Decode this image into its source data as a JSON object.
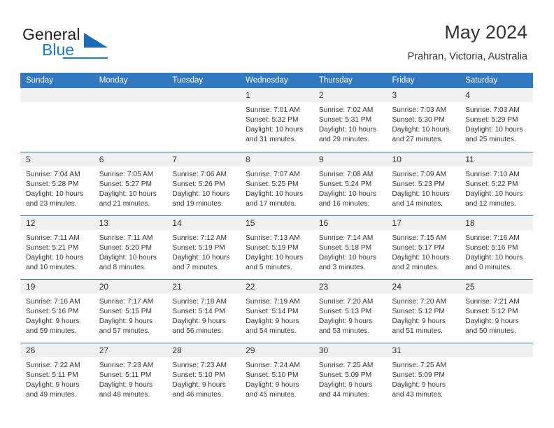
{
  "brand": {
    "name_part1": "General",
    "name_part2": "Blue",
    "accent_color": "#1a7cc4",
    "triangle_color": "#1b6cb3"
  },
  "header": {
    "title": "May 2024",
    "location": "Prahran, Victoria, Australia"
  },
  "calendar": {
    "header_bg": "#3178be",
    "header_text_color": "#ffffff",
    "daynum_bg": "#f0f0f0",
    "weekdays": [
      "Sunday",
      "Monday",
      "Tuesday",
      "Wednesday",
      "Thursday",
      "Friday",
      "Saturday"
    ],
    "weeks": [
      [
        {
          "day": "",
          "sunrise": "",
          "sunset": "",
          "daylight_line1": "",
          "daylight_line2": ""
        },
        {
          "day": "",
          "sunrise": "",
          "sunset": "",
          "daylight_line1": "",
          "daylight_line2": ""
        },
        {
          "day": "",
          "sunrise": "",
          "sunset": "",
          "daylight_line1": "",
          "daylight_line2": ""
        },
        {
          "day": "1",
          "sunrise": "Sunrise: 7:01 AM",
          "sunset": "Sunset: 5:32 PM",
          "daylight_line1": "Daylight: 10 hours",
          "daylight_line2": "and 31 minutes."
        },
        {
          "day": "2",
          "sunrise": "Sunrise: 7:02 AM",
          "sunset": "Sunset: 5:31 PM",
          "daylight_line1": "Daylight: 10 hours",
          "daylight_line2": "and 29 minutes."
        },
        {
          "day": "3",
          "sunrise": "Sunrise: 7:03 AM",
          "sunset": "Sunset: 5:30 PM",
          "daylight_line1": "Daylight: 10 hours",
          "daylight_line2": "and 27 minutes."
        },
        {
          "day": "4",
          "sunrise": "Sunrise: 7:03 AM",
          "sunset": "Sunset: 5:29 PM",
          "daylight_line1": "Daylight: 10 hours",
          "daylight_line2": "and 25 minutes."
        }
      ],
      [
        {
          "day": "5",
          "sunrise": "Sunrise: 7:04 AM",
          "sunset": "Sunset: 5:28 PM",
          "daylight_line1": "Daylight: 10 hours",
          "daylight_line2": "and 23 minutes."
        },
        {
          "day": "6",
          "sunrise": "Sunrise: 7:05 AM",
          "sunset": "Sunset: 5:27 PM",
          "daylight_line1": "Daylight: 10 hours",
          "daylight_line2": "and 21 minutes."
        },
        {
          "day": "7",
          "sunrise": "Sunrise: 7:06 AM",
          "sunset": "Sunset: 5:26 PM",
          "daylight_line1": "Daylight: 10 hours",
          "daylight_line2": "and 19 minutes."
        },
        {
          "day": "8",
          "sunrise": "Sunrise: 7:07 AM",
          "sunset": "Sunset: 5:25 PM",
          "daylight_line1": "Daylight: 10 hours",
          "daylight_line2": "and 17 minutes."
        },
        {
          "day": "9",
          "sunrise": "Sunrise: 7:08 AM",
          "sunset": "Sunset: 5:24 PM",
          "daylight_line1": "Daylight: 10 hours",
          "daylight_line2": "and 16 minutes."
        },
        {
          "day": "10",
          "sunrise": "Sunrise: 7:09 AM",
          "sunset": "Sunset: 5:23 PM",
          "daylight_line1": "Daylight: 10 hours",
          "daylight_line2": "and 14 minutes."
        },
        {
          "day": "11",
          "sunrise": "Sunrise: 7:10 AM",
          "sunset": "Sunset: 5:22 PM",
          "daylight_line1": "Daylight: 10 hours",
          "daylight_line2": "and 12 minutes."
        }
      ],
      [
        {
          "day": "12",
          "sunrise": "Sunrise: 7:11 AM",
          "sunset": "Sunset: 5:21 PM",
          "daylight_line1": "Daylight: 10 hours",
          "daylight_line2": "and 10 minutes."
        },
        {
          "day": "13",
          "sunrise": "Sunrise: 7:11 AM",
          "sunset": "Sunset: 5:20 PM",
          "daylight_line1": "Daylight: 10 hours",
          "daylight_line2": "and 8 minutes."
        },
        {
          "day": "14",
          "sunrise": "Sunrise: 7:12 AM",
          "sunset": "Sunset: 5:19 PM",
          "daylight_line1": "Daylight: 10 hours",
          "daylight_line2": "and 7 minutes."
        },
        {
          "day": "15",
          "sunrise": "Sunrise: 7:13 AM",
          "sunset": "Sunset: 5:19 PM",
          "daylight_line1": "Daylight: 10 hours",
          "daylight_line2": "and 5 minutes."
        },
        {
          "day": "16",
          "sunrise": "Sunrise: 7:14 AM",
          "sunset": "Sunset: 5:18 PM",
          "daylight_line1": "Daylight: 10 hours",
          "daylight_line2": "and 3 minutes."
        },
        {
          "day": "17",
          "sunrise": "Sunrise: 7:15 AM",
          "sunset": "Sunset: 5:17 PM",
          "daylight_line1": "Daylight: 10 hours",
          "daylight_line2": "and 2 minutes."
        },
        {
          "day": "18",
          "sunrise": "Sunrise: 7:16 AM",
          "sunset": "Sunset: 5:16 PM",
          "daylight_line1": "Daylight: 10 hours",
          "daylight_line2": "and 0 minutes."
        }
      ],
      [
        {
          "day": "19",
          "sunrise": "Sunrise: 7:16 AM",
          "sunset": "Sunset: 5:16 PM",
          "daylight_line1": "Daylight: 9 hours",
          "daylight_line2": "and 59 minutes."
        },
        {
          "day": "20",
          "sunrise": "Sunrise: 7:17 AM",
          "sunset": "Sunset: 5:15 PM",
          "daylight_line1": "Daylight: 9 hours",
          "daylight_line2": "and 57 minutes."
        },
        {
          "day": "21",
          "sunrise": "Sunrise: 7:18 AM",
          "sunset": "Sunset: 5:14 PM",
          "daylight_line1": "Daylight: 9 hours",
          "daylight_line2": "and 56 minutes."
        },
        {
          "day": "22",
          "sunrise": "Sunrise: 7:19 AM",
          "sunset": "Sunset: 5:14 PM",
          "daylight_line1": "Daylight: 9 hours",
          "daylight_line2": "and 54 minutes."
        },
        {
          "day": "23",
          "sunrise": "Sunrise: 7:20 AM",
          "sunset": "Sunset: 5:13 PM",
          "daylight_line1": "Daylight: 9 hours",
          "daylight_line2": "and 53 minutes."
        },
        {
          "day": "24",
          "sunrise": "Sunrise: 7:20 AM",
          "sunset": "Sunset: 5:12 PM",
          "daylight_line1": "Daylight: 9 hours",
          "daylight_line2": "and 51 minutes."
        },
        {
          "day": "25",
          "sunrise": "Sunrise: 7:21 AM",
          "sunset": "Sunset: 5:12 PM",
          "daylight_line1": "Daylight: 9 hours",
          "daylight_line2": "and 50 minutes."
        }
      ],
      [
        {
          "day": "26",
          "sunrise": "Sunrise: 7:22 AM",
          "sunset": "Sunset: 5:11 PM",
          "daylight_line1": "Daylight: 9 hours",
          "daylight_line2": "and 49 minutes."
        },
        {
          "day": "27",
          "sunrise": "Sunrise: 7:23 AM",
          "sunset": "Sunset: 5:11 PM",
          "daylight_line1": "Daylight: 9 hours",
          "daylight_line2": "and 48 minutes."
        },
        {
          "day": "28",
          "sunrise": "Sunrise: 7:23 AM",
          "sunset": "Sunset: 5:10 PM",
          "daylight_line1": "Daylight: 9 hours",
          "daylight_line2": "and 46 minutes."
        },
        {
          "day": "29",
          "sunrise": "Sunrise: 7:24 AM",
          "sunset": "Sunset: 5:10 PM",
          "daylight_line1": "Daylight: 9 hours",
          "daylight_line2": "and 45 minutes."
        },
        {
          "day": "30",
          "sunrise": "Sunrise: 7:25 AM",
          "sunset": "Sunset: 5:09 PM",
          "daylight_line1": "Daylight: 9 hours",
          "daylight_line2": "and 44 minutes."
        },
        {
          "day": "31",
          "sunrise": "Sunrise: 7:25 AM",
          "sunset": "Sunset: 5:09 PM",
          "daylight_line1": "Daylight: 9 hours",
          "daylight_line2": "and 43 minutes."
        },
        {
          "day": "",
          "sunrise": "",
          "sunset": "",
          "daylight_line1": "",
          "daylight_line2": ""
        }
      ]
    ]
  }
}
